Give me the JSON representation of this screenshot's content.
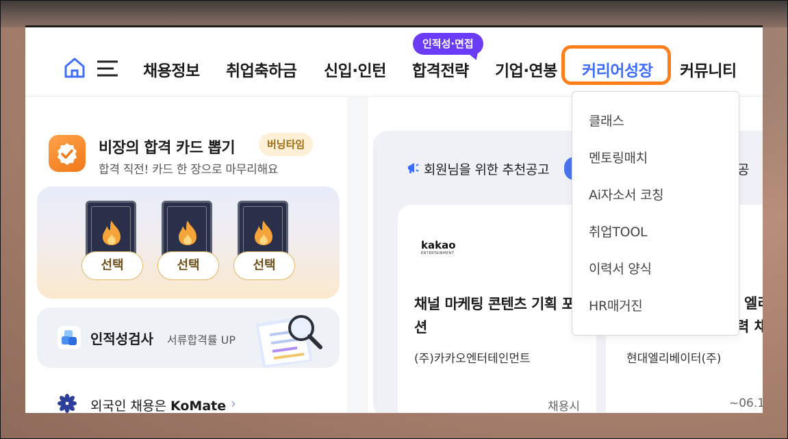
{
  "nav": {
    "items": [
      "채용정보",
      "취업축하금",
      "신입·인턴",
      "합격전략",
      "기업·연봉",
      "커리어성장",
      "커뮤니티"
    ],
    "badge": "인적성·면접",
    "active_color": "#3d6dfa",
    "highlight_color": "#ff7f1c"
  },
  "dropdown": {
    "items": [
      "클래스",
      "멘토링매치",
      "Ai자소서 코칭",
      "취업TOOL",
      "이력서 양식",
      "HR매거진"
    ]
  },
  "card_draw": {
    "title": "비장의 합격 카드 뽑기",
    "tag": "버닝타임",
    "subtitle": "합격 직전! 카드 한 장으로 마무리해요",
    "select_labels": [
      "선택",
      "선택",
      "선택"
    ]
  },
  "aptitude": {
    "title": "인적성검사",
    "subtitle": "서류합격률 UP"
  },
  "komate": {
    "text": "외국인 채용은 ",
    "brand": "KoMate",
    "chevron": "›"
  },
  "recommend": {
    "title": "회원님을 위한 추천공고",
    "right_text": "공"
  },
  "jobs": [
    {
      "logo": "kakao",
      "logo_sub": "ENTERTAINMENT",
      "title": "채널 마케팅 콘텐츠 기획 포지션",
      "company": "(주)카카오엔터테인먼트",
      "deadline": "채용시"
    },
    {
      "title_line1": "엘리",
      "title_line2": "력 채",
      "company": "현대엘리베이터(주)",
      "deadline": "~06.1"
    }
  ]
}
